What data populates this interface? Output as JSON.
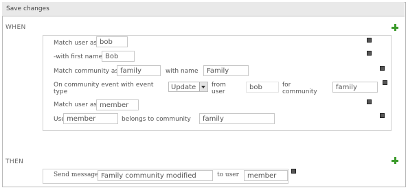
{
  "toolbar": {
    "save_label": "Save changes"
  },
  "when": {
    "label": "WHEN",
    "rows": {
      "r1": {
        "label": "Match user as",
        "value": "bob"
      },
      "r2": {
        "label": "-with first name",
        "value": "Bob"
      },
      "r3": {
        "label": "Match community as",
        "value": "family",
        "label2": "with name",
        "value2": "Family"
      },
      "r4": {
        "label_line1": "On community event with event",
        "label_line2": "type",
        "select_value": "Update",
        "from_line1": "from",
        "from_line2": "user",
        "user_value": "bob",
        "for_line1": "for",
        "for_line2": "community",
        "community_value": "family"
      },
      "r5": {
        "label": "Match user as",
        "value": "member"
      },
      "r6": {
        "label": "User",
        "value": "member",
        "label2": "belongs to community",
        "value2": "family"
      }
    }
  },
  "then": {
    "label": "THEN",
    "action": {
      "label": "Send message",
      "value": "Family community modified",
      "label2": "to user",
      "value2": "member"
    }
  }
}
